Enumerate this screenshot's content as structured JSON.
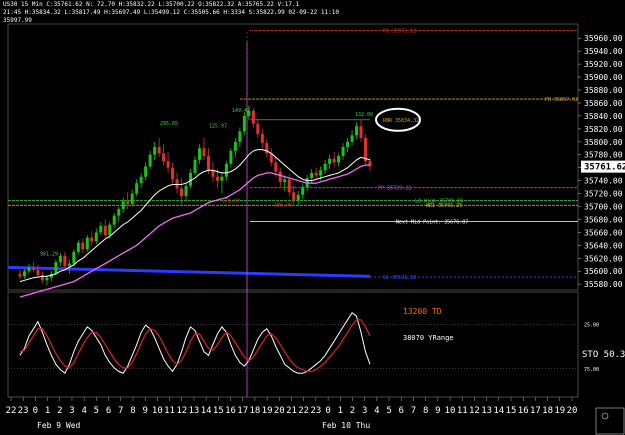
{
  "header": {
    "line1": "US30  15 Min  C:35761.62  N:  72.70  H:35832.22  L:35700.22  O:35822.32  A:35765.22  V:17.1",
    "line2": "21:45  H:35834.32  L:35817.49  H:35697.49  L:35499.12  C:35505.66  H:3334  S:35822.99  02-09-22  11:10",
    "line3": "35997.99"
  },
  "chart_data": {
    "type": "candlestick",
    "price_axis": {
      "ticks": [
        35960,
        35940,
        35920,
        35900,
        35880,
        35860,
        35840,
        35820,
        35800,
        35780,
        35760,
        35740,
        35720,
        35700,
        35680,
        35660,
        35640,
        35620,
        35600,
        35580
      ],
      "labels": [
        "35960.00",
        "35940.00",
        "35920.00",
        "35900.00",
        "35880.00",
        "35860.00",
        "35840.00",
        "35820.00",
        "35800.00",
        "35780.00",
        "35760.00",
        "35740.00",
        "35720.00",
        "35700.00",
        "35680.00",
        "35660.00",
        "35640.00",
        "35620.00",
        "35600.00",
        "35580.00"
      ],
      "last_price": 35761.62,
      "last_price_label": "35761.62"
    },
    "time_axis": {
      "hours": [
        "22",
        "23",
        "0",
        "1",
        "2",
        "3",
        "4",
        "5",
        "6",
        "7",
        "8",
        "9",
        "10",
        "11",
        "12",
        "13",
        "14",
        "15",
        "16",
        "17",
        "18",
        "19",
        "20",
        "21",
        "22",
        "23",
        "0",
        "1",
        "2",
        "3",
        "4",
        "5",
        "6",
        "7",
        "8",
        "9",
        "10",
        "11",
        "12",
        "13",
        "14",
        "15",
        "16",
        "17",
        "18",
        "19",
        "20"
      ],
      "day_labels": [
        "Feb 9 Wed",
        "Feb 10 Thu"
      ]
    },
    "candles": [
      [
        35596,
        35602,
        35588,
        35592
      ],
      [
        35592,
        35604,
        35588,
        35600
      ],
      [
        35600,
        35612,
        35596,
        35606
      ],
      [
        35606,
        35614,
        35598,
        35602
      ],
      [
        35602,
        35610,
        35590,
        35594
      ],
      [
        35594,
        35600,
        35582,
        35586
      ],
      [
        35586,
        35594,
        35578,
        35590
      ],
      [
        35590,
        35600,
        35584,
        35596
      ],
      [
        35596,
        35618,
        35594,
        35614
      ],
      [
        35614,
        35628,
        35608,
        35624
      ],
      [
        35624,
        35630,
        35604,
        35608
      ],
      [
        35608,
        35618,
        35596,
        35612
      ],
      [
        35612,
        35634,
        35608,
        35630
      ],
      [
        35630,
        35648,
        35626,
        35644
      ],
      [
        35644,
        35650,
        35628,
        35634
      ],
      [
        35634,
        35656,
        35630,
        35652
      ],
      [
        35652,
        35662,
        35640,
        35646
      ],
      [
        35646,
        35666,
        35642,
        35660
      ],
      [
        35660,
        35676,
        35656,
        35670
      ],
      [
        35670,
        35680,
        35652,
        35656
      ],
      [
        35656,
        35676,
        35650,
        35672
      ],
      [
        35672,
        35690,
        35666,
        35686
      ],
      [
        35686,
        35700,
        35676,
        35696
      ],
      [
        35696,
        35714,
        35690,
        35708
      ],
      [
        35708,
        35722,
        35696,
        35704
      ],
      [
        35704,
        35726,
        35700,
        35720
      ],
      [
        35720,
        35742,
        35716,
        35736
      ],
      [
        35736,
        35752,
        35728,
        35746
      ],
      [
        35746,
        35768,
        35740,
        35762
      ],
      [
        35762,
        35786,
        35758,
        35780
      ],
      [
        35780,
        35800,
        35772,
        35792
      ],
      [
        35792,
        35806,
        35776,
        35782
      ],
      [
        35782,
        35796,
        35764,
        35770
      ],
      [
        35770,
        35784,
        35752,
        35760
      ],
      [
        35760,
        35768,
        35736,
        35742
      ],
      [
        35742,
        35752,
        35720,
        35728
      ],
      [
        35728,
        35744,
        35704,
        35716
      ],
      [
        35716,
        35736,
        35710,
        35732
      ],
      [
        35732,
        35758,
        35728,
        35752
      ],
      [
        35752,
        35778,
        35748,
        35772
      ],
      [
        35772,
        35796,
        35766,
        35790
      ],
      [
        35790,
        35806,
        35772,
        35778
      ],
      [
        35778,
        35790,
        35750,
        35756
      ],
      [
        35756,
        35770,
        35738,
        35746
      ],
      [
        35746,
        35758,
        35728,
        35740
      ],
      [
        35740,
        35752,
        35720,
        35746
      ],
      [
        35746,
        35770,
        35740,
        35766
      ],
      [
        35766,
        35790,
        35760,
        35786
      ],
      [
        35786,
        35806,
        35776,
        35800
      ],
      [
        35800,
        35822,
        35792,
        35816
      ],
      [
        35816,
        35846,
        35810,
        35840
      ],
      [
        35840,
        35856,
        35834,
        35848
      ],
      [
        35848,
        35852,
        35822,
        35828
      ],
      [
        35828,
        35836,
        35806,
        35812
      ],
      [
        35812,
        35820,
        35790,
        35798
      ],
      [
        35798,
        35804,
        35776,
        35782
      ],
      [
        35782,
        35790,
        35762,
        35768
      ],
      [
        35768,
        35776,
        35746,
        35754
      ],
      [
        35754,
        35760,
        35730,
        35738
      ],
      [
        35738,
        35748,
        35724,
        35742
      ],
      [
        35742,
        35750,
        35716,
        35722
      ],
      [
        35722,
        35732,
        35704,
        35710
      ],
      [
        35710,
        35724,
        35702,
        35718
      ],
      [
        35718,
        35736,
        35712,
        35730
      ],
      [
        35730,
        35748,
        35724,
        35744
      ],
      [
        35744,
        35758,
        35736,
        35752
      ],
      [
        35752,
        35760,
        35742,
        35748
      ],
      [
        35748,
        35762,
        35740,
        35756
      ],
      [
        35756,
        35772,
        35750,
        35766
      ],
      [
        35766,
        35780,
        35758,
        35774
      ],
      [
        35774,
        35784,
        35760,
        35768
      ],
      [
        35768,
        35782,
        35762,
        35778
      ],
      [
        35778,
        35798,
        35772,
        35792
      ],
      [
        35792,
        35806,
        35784,
        35800
      ],
      [
        35800,
        35818,
        35794,
        35810
      ],
      [
        35810,
        35830,
        35804,
        35824
      ],
      [
        35824,
        35834,
        35800,
        35806
      ],
      [
        35806,
        35812,
        35762,
        35770
      ],
      [
        35770,
        35776,
        35754,
        35762
      ]
    ],
    "ma_white": [
      35584,
      35586,
      35588,
      35590,
      35591,
      35592,
      35592,
      35594,
      35596,
      35600,
      35602,
      35606,
      35610,
      35616,
      35620,
      35626,
      35632,
      35638,
      35644,
      35650,
      35654,
      35660,
      35666,
      35672,
      35676,
      35682,
      35688,
      35694,
      35702,
      35710,
      35718,
      35724,
      35728,
      35732,
      35734,
      35734,
      35734,
      35736,
      35740,
      35744,
      35750,
      35754,
      35756,
      35756,
      35754,
      35752,
      35752,
      35754,
      35758,
      35764,
      35772,
      35780,
      35786,
      35788,
      35788,
      35786,
      35782,
      35776,
      35770,
      35764,
      35758,
      35752,
      35746,
      35742,
      35740,
      35740,
      35742,
      35744,
      35746,
      35748,
      35750,
      35752,
      35756,
      35760,
      35766,
      35772,
      35776,
      35774,
      35772
    ],
    "ma_pink": [
      35560,
      35562,
      35564,
      35566,
      35568,
      35570,
      35572,
      35574,
      35576,
      35578,
      35580,
      35582,
      35584,
      35588,
      35592,
      35596,
      35600,
      35604,
      35608,
      35612,
      35616,
      35620,
      35624,
      35628,
      35632,
      35636,
      35640,
      35646,
      35652,
      35658,
      35664,
      35670,
      35674,
      35678,
      35682,
      35684,
      35686,
      35688,
      35690,
      35694,
      35698,
      35702,
      35706,
      35708,
      35710,
      35712,
      35714,
      35718,
      35722,
      35726,
      35732,
      35738,
      35744,
      35748,
      35750,
      35752,
      35752,
      35750,
      35748,
      35746,
      35744,
      35742,
      35740,
      35738,
      35736,
      35736,
      35736,
      35738,
      35740,
      35742,
      35744,
      35746,
      35748,
      35750,
      35754,
      35758,
      35762,
      35764,
      35764
    ],
    "levels": [
      {
        "label": "R1 35972.12",
        "value": 35972
      },
      {
        "label": "PH 35867.02",
        "value": 35866
      },
      {
        "label": "RNR 35834.32",
        "value": 35834
      },
      {
        "label": "PP 35729.22",
        "value": 35729
      },
      {
        "label": "L4 High 35708.83",
        "value": 35709
      },
      {
        "label": "WR1 35701.25",
        "value": 35702
      },
      {
        "label": "Next Mid Point: 35676.87",
        "value": 35677
      },
      {
        "label": "S1 35591.32",
        "value": 35591
      }
    ],
    "annotations": [
      "149.42",
      "132.00",
      "125.97",
      "295.65",
      "981.29",
      "171.90",
      "190.00"
    ],
    "oscillator": {
      "label": "STO",
      "value_label": "50.3",
      "levels": [
        "25.00",
        "75.00"
      ],
      "k": [
        40,
        48,
        62,
        70,
        78,
        66,
        52,
        40,
        30,
        24,
        20,
        30,
        44,
        56,
        64,
        72,
        68,
        60,
        52,
        40,
        32,
        26,
        22,
        20,
        28,
        40,
        52,
        66,
        74,
        70,
        60,
        48,
        36,
        28,
        22,
        30,
        44,
        60,
        72,
        68,
        56,
        44,
        40,
        52,
        64,
        72,
        66,
        52,
        40,
        32,
        28,
        34,
        46,
        58,
        66,
        70,
        62,
        50,
        40,
        30,
        26,
        22,
        20,
        20,
        22,
        26,
        30,
        34,
        40,
        48,
        56,
        64,
        72,
        80,
        88,
        84,
        66,
        44,
        30
      ],
      "d": [
        44,
        46,
        54,
        62,
        70,
        70,
        62,
        52,
        42,
        34,
        28,
        26,
        32,
        42,
        52,
        60,
        66,
        66,
        60,
        52,
        44,
        36,
        30,
        26,
        26,
        32,
        42,
        54,
        64,
        70,
        68,
        62,
        52,
        42,
        34,
        30,
        34,
        44,
        56,
        64,
        64,
        56,
        48,
        46,
        52,
        60,
        66,
        62,
        54,
        46,
        38,
        34,
        38,
        46,
        54,
        62,
        64,
        60,
        52,
        44,
        36,
        30,
        26,
        24,
        22,
        22,
        24,
        28,
        32,
        38,
        44,
        50,
        58,
        66,
        74,
        80,
        80,
        72,
        62
      ]
    },
    "text_notes": [
      "13200 TD",
      "38070 YRange"
    ]
  }
}
